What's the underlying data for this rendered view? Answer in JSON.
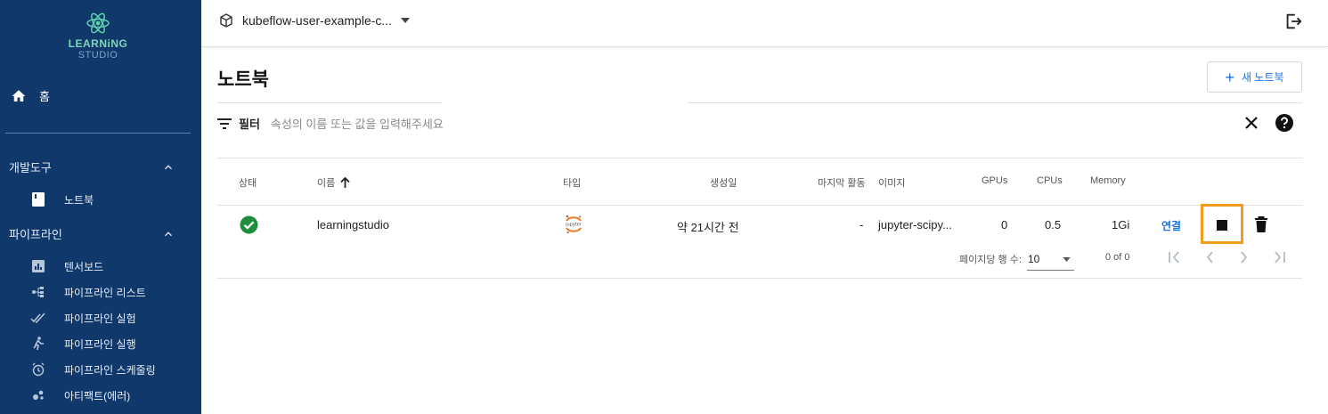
{
  "brand": {
    "line1": "LEARNiNG",
    "line2": "STUDIO"
  },
  "sidebar": {
    "home": "홈",
    "sections": [
      {
        "label": "개발도구",
        "items": [
          {
            "label": "노트북",
            "icon": "notebook-icon"
          }
        ]
      },
      {
        "label": "파이프라인",
        "items": [
          {
            "label": "텐서보드",
            "icon": "tensorboard-icon"
          },
          {
            "label": "파이프라인 리스트",
            "icon": "pipeline-list-icon"
          },
          {
            "label": "파이프라인 실험",
            "icon": "experiment-icon"
          },
          {
            "label": "파이프라인 실행",
            "icon": "run-icon"
          },
          {
            "label": "파이프라인 스케줄링",
            "icon": "alarm-icon"
          },
          {
            "label": "아티팩트(에러)",
            "icon": "artifact-icon"
          }
        ]
      }
    ]
  },
  "topbar": {
    "namespace": "kubeflow-user-example-c..."
  },
  "page": {
    "title": "노트북",
    "new_button": "새 노트북"
  },
  "filter": {
    "label": "필터",
    "placeholder": "속성의 이름 또는 값을 입력해주세요"
  },
  "table": {
    "headers": {
      "status": "상태",
      "name": "이름",
      "type": "타입",
      "created": "생성일",
      "last_activity": "마지막 활동",
      "image": "이미지",
      "gpus": "GPUs",
      "cpus": "CPUs",
      "memory": "Memory"
    },
    "rows": [
      {
        "status": "ready",
        "name": "learningstudio",
        "type": "jupyter",
        "created": "약 21시간 전",
        "last_activity": "-",
        "image": "jupyter-scipy...",
        "gpus": "0",
        "cpus": "0.5",
        "memory": "1Gi",
        "connect": "연결"
      }
    ]
  },
  "pagination": {
    "rows_label": "페이지당 행 수:",
    "rows_value": "10",
    "range": "0 of 0"
  },
  "colors": {
    "sidebar_bg": "#10386b",
    "accent": "#1a73e8",
    "status_ok": "#1e8e3e",
    "highlight": "#f39c1b"
  }
}
